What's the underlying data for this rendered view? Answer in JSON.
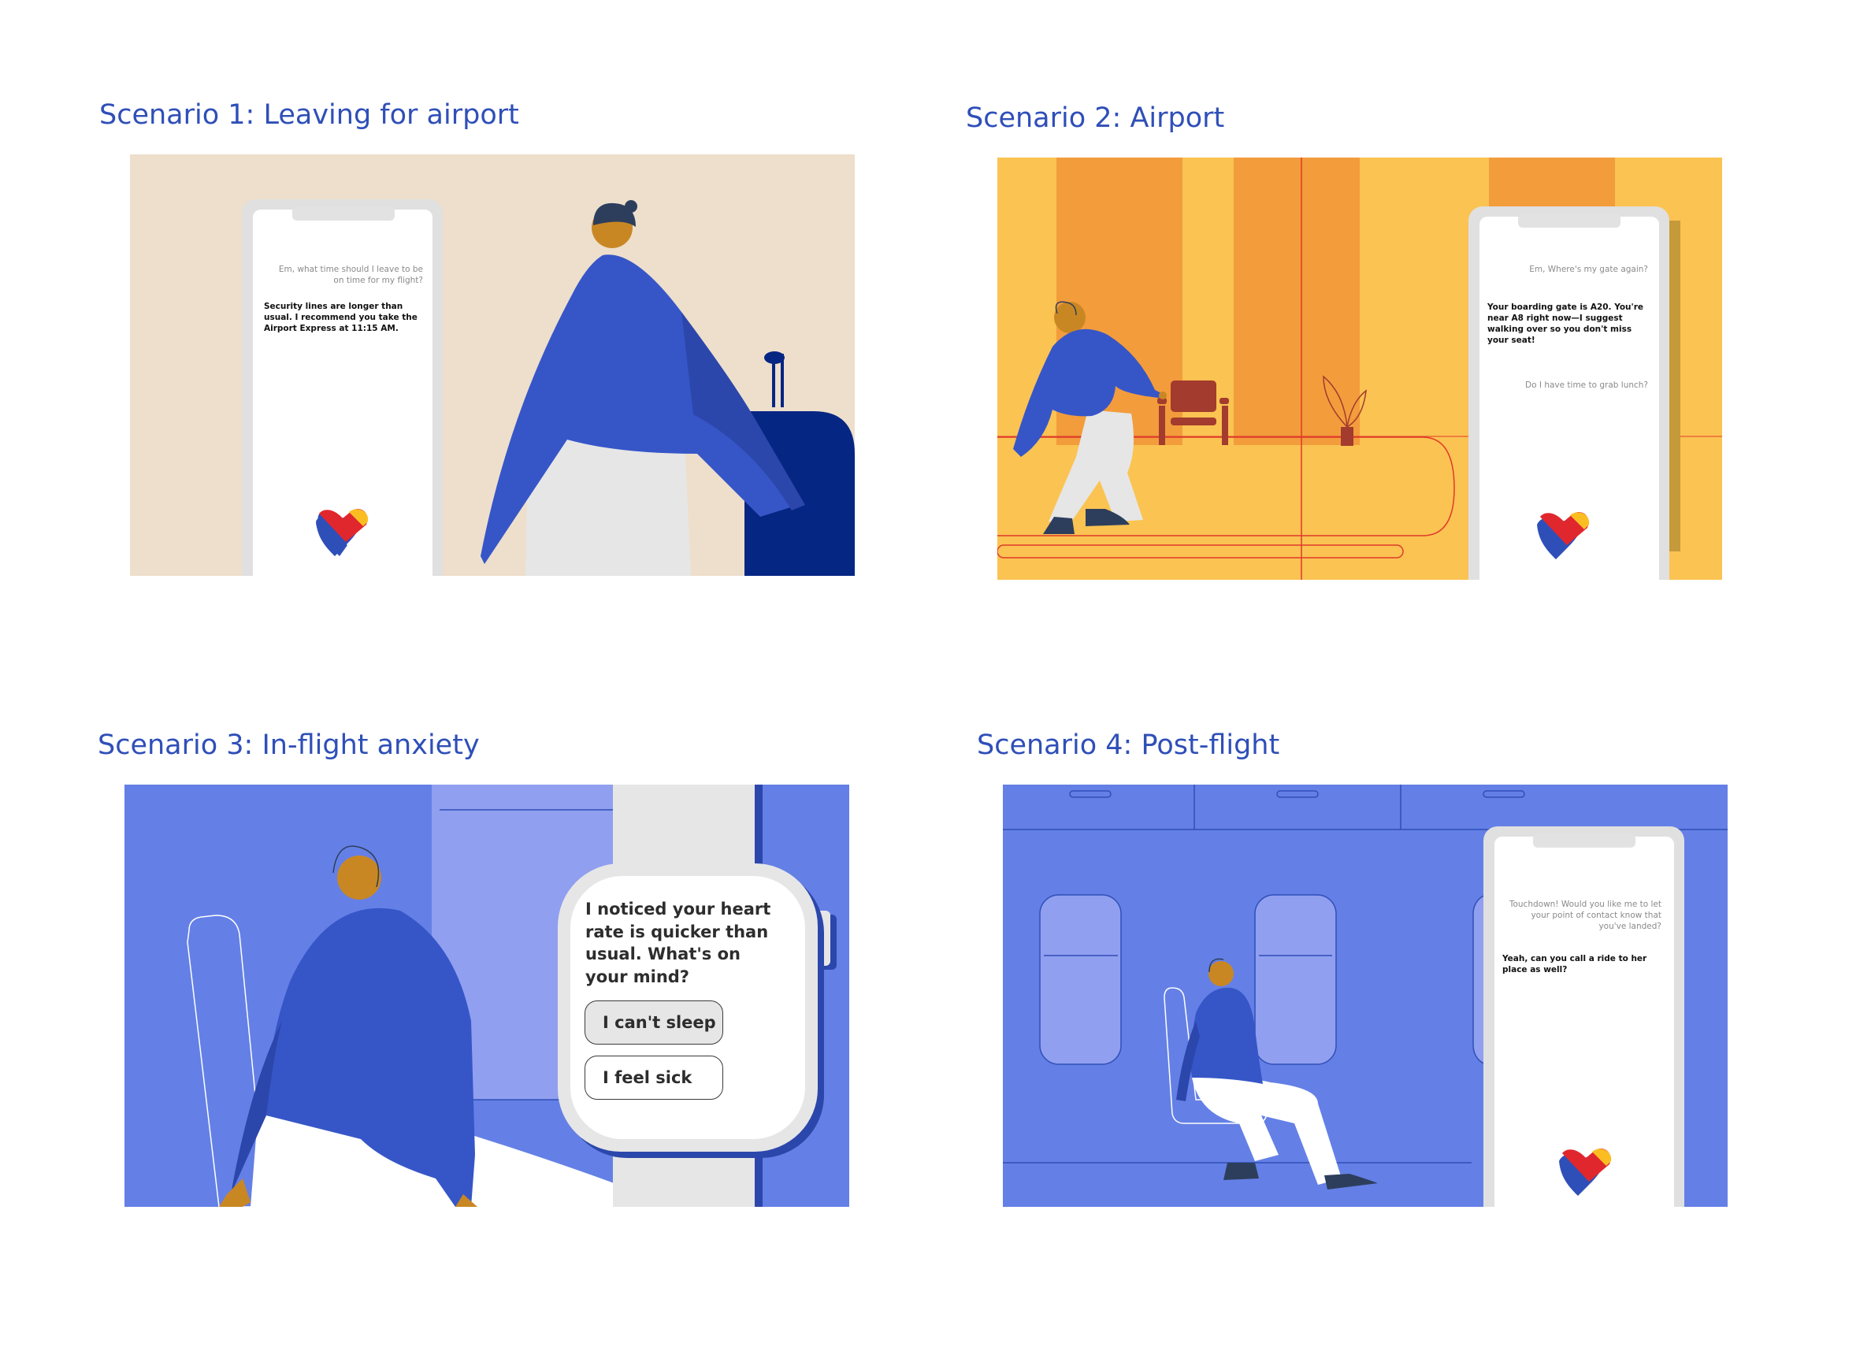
{
  "scenarios": [
    {
      "title": "Scenario 1: Leaving for airport",
      "chat": [
        {
          "role": "user",
          "text": "Em, what time should I leave to be on time for my flight?"
        },
        {
          "role": "assistant",
          "text": "Security lines are longer than usual. I recommend you take the Airport Express at 11:15 AM."
        }
      ]
    },
    {
      "title": "Scenario 2: Airport",
      "chat": [
        {
          "role": "user",
          "text": "Em, Where's my gate again?"
        },
        {
          "role": "assistant",
          "text": "Your boarding gate is A20. You're near A8 right now—I suggest walking over so you don't miss your seat!"
        },
        {
          "role": "user",
          "text": "Do I have time to grab lunch?"
        }
      ]
    },
    {
      "title": "Scenario 3: In-flight anxiety",
      "watch": {
        "message": "I noticed your heart rate is quicker than usual. What's on your mind?",
        "options": [
          "I can't sleep",
          "I feel sick"
        ]
      }
    },
    {
      "title": "Scenario 4: Post-flight",
      "chat": [
        {
          "role": "assistant",
          "text": "Touchdown! Would you like me to let your point of contact know that you've landed?"
        },
        {
          "role": "user",
          "text": "Yeah, can you call a ride to her place as well?"
        }
      ]
    }
  ],
  "colors": {
    "title": "#2f4fb8",
    "beige": "#eddfcc",
    "airport_yellow": "#fbc352",
    "airport_orange": "#f39c3c",
    "cabin_blue": "#6480e6",
    "window_blue": "#909fef",
    "shirt_blue": "#3656c8",
    "luggage_navy": "#062683",
    "skin": "#c98723",
    "phone_grey": "#e5e5e5",
    "heart_red": "#e0272d",
    "heart_yellow": "#fbbe22",
    "heart_blue": "#2f4fb8"
  },
  "icons": [
    "heart-logo-icon",
    "smartwatch-icon",
    "smartphone-icon"
  ]
}
